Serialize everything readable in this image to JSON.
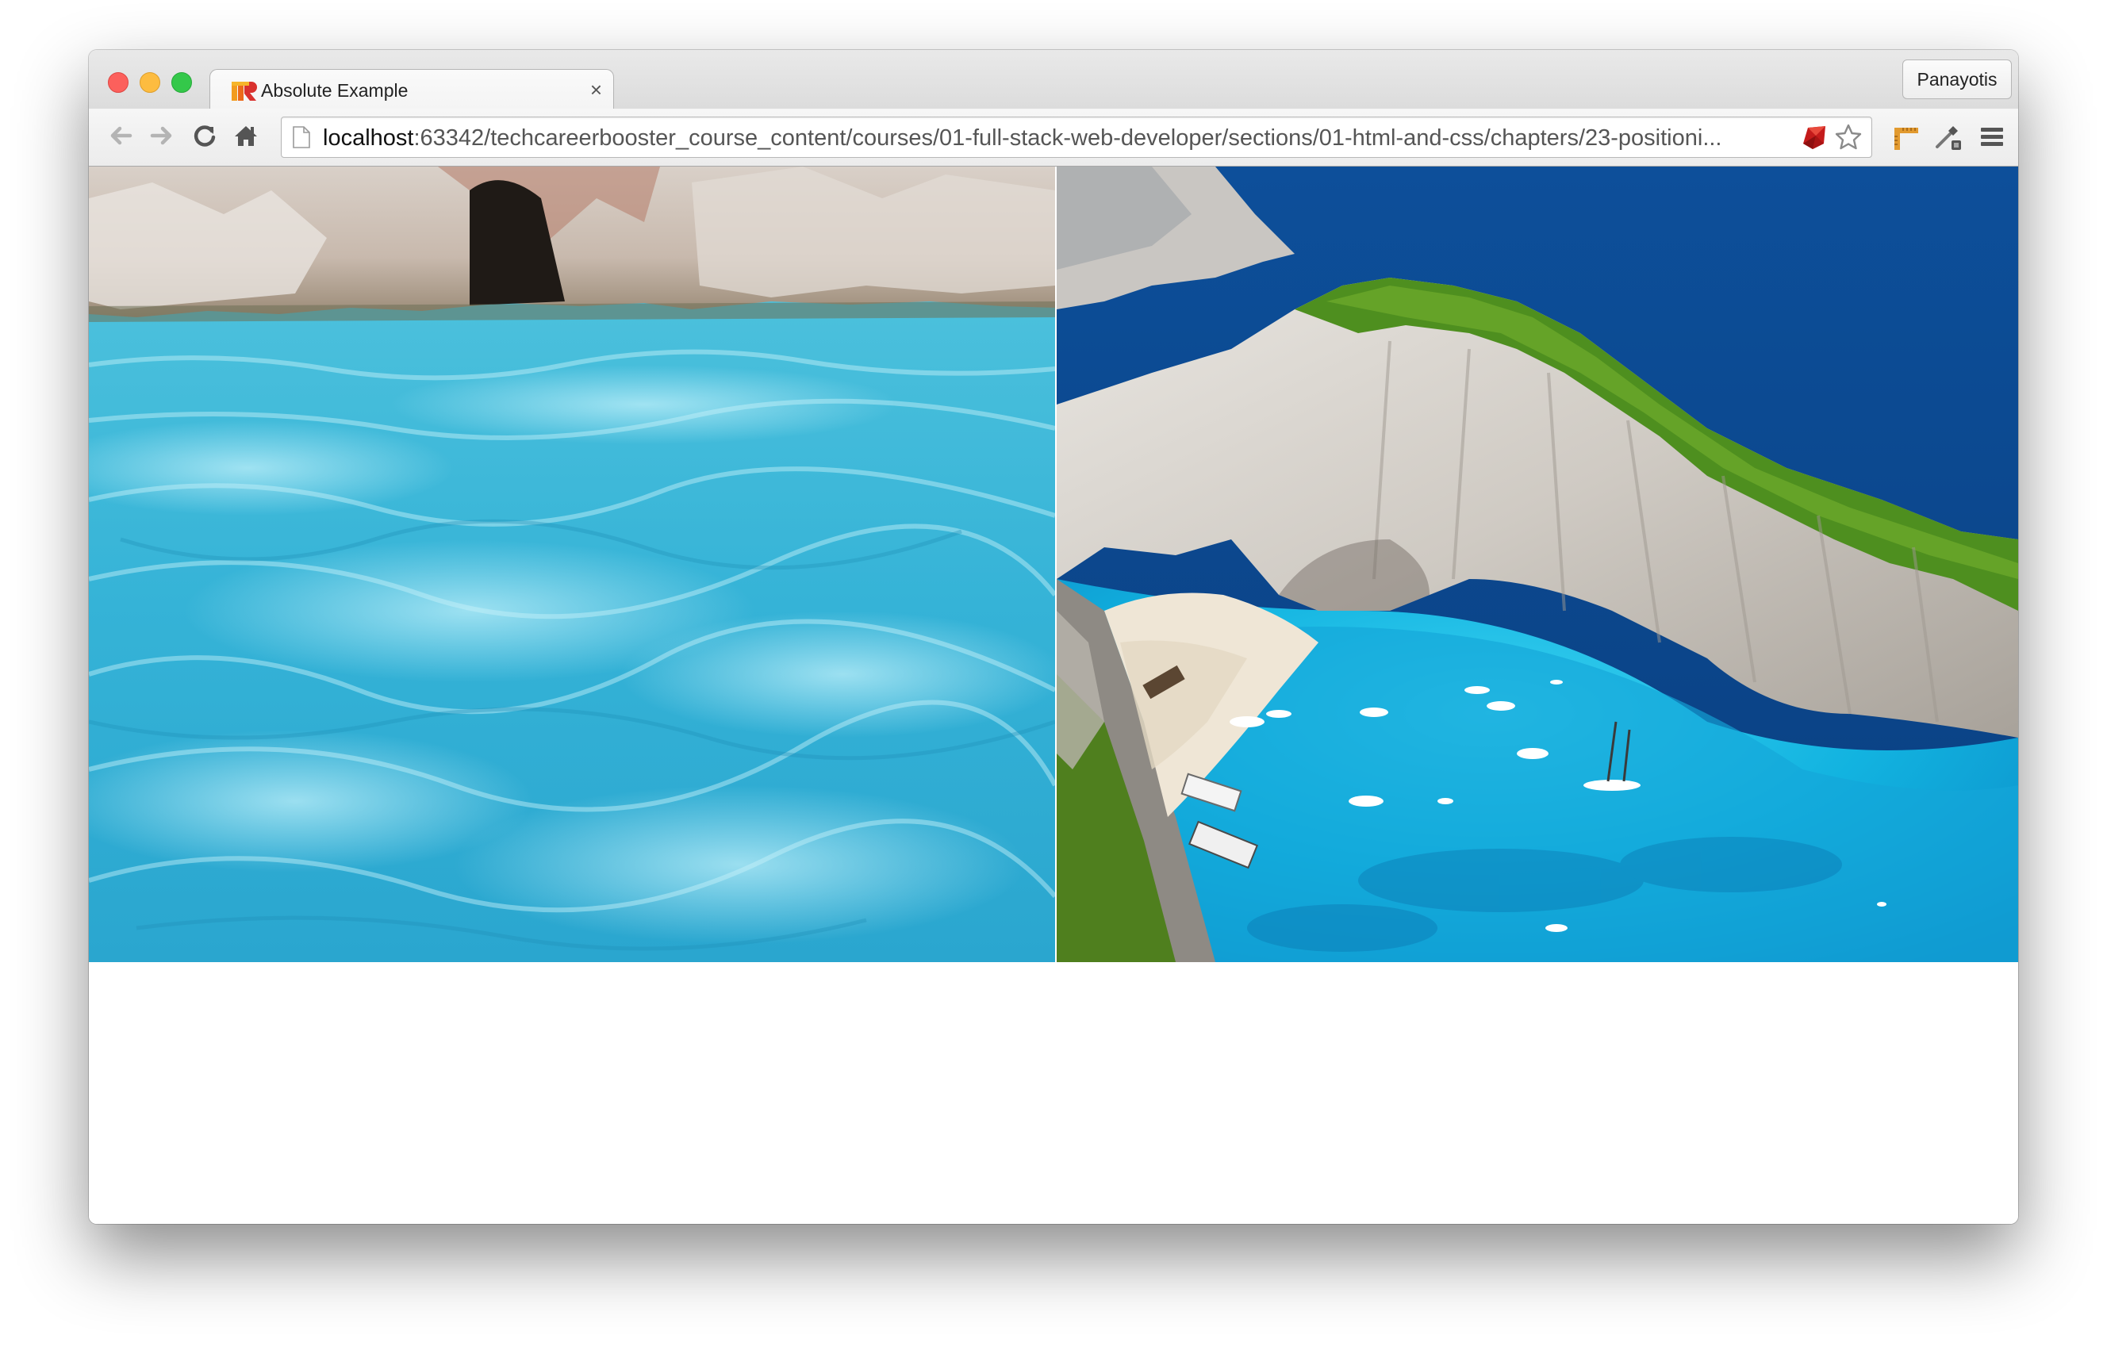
{
  "window": {
    "tab_title": "Absolute Example",
    "tab_close_glyph": "×",
    "profile_name": "Panayotis"
  },
  "toolbar": {
    "url_host": "localhost",
    "url_rest": ":63342/techcareerbooster_course_content/courses/01-full-stack-web-developer/sections/01-html-and-css/chapters/23-positioni..."
  },
  "icons": {
    "tab_favicon": "rubymine-icon",
    "back": "back-arrow-icon",
    "forward": "forward-arrow-icon",
    "reload": "reload-icon",
    "home": "home-icon",
    "page": "page-icon",
    "ruby": "ruby-gem-icon",
    "bookmark": "star-icon",
    "extension_1": "ruler-icon",
    "extension_2": "eyedropper-icon",
    "menu": "hamburger-menu-icon"
  },
  "colors": {
    "traffic_red": "#fc605c",
    "traffic_yellow": "#fdbc40",
    "traffic_green": "#34c84a",
    "water": "#3fb8d8",
    "sea_deep": "#0b4a8e",
    "lagoon": "#12b3e0"
  }
}
